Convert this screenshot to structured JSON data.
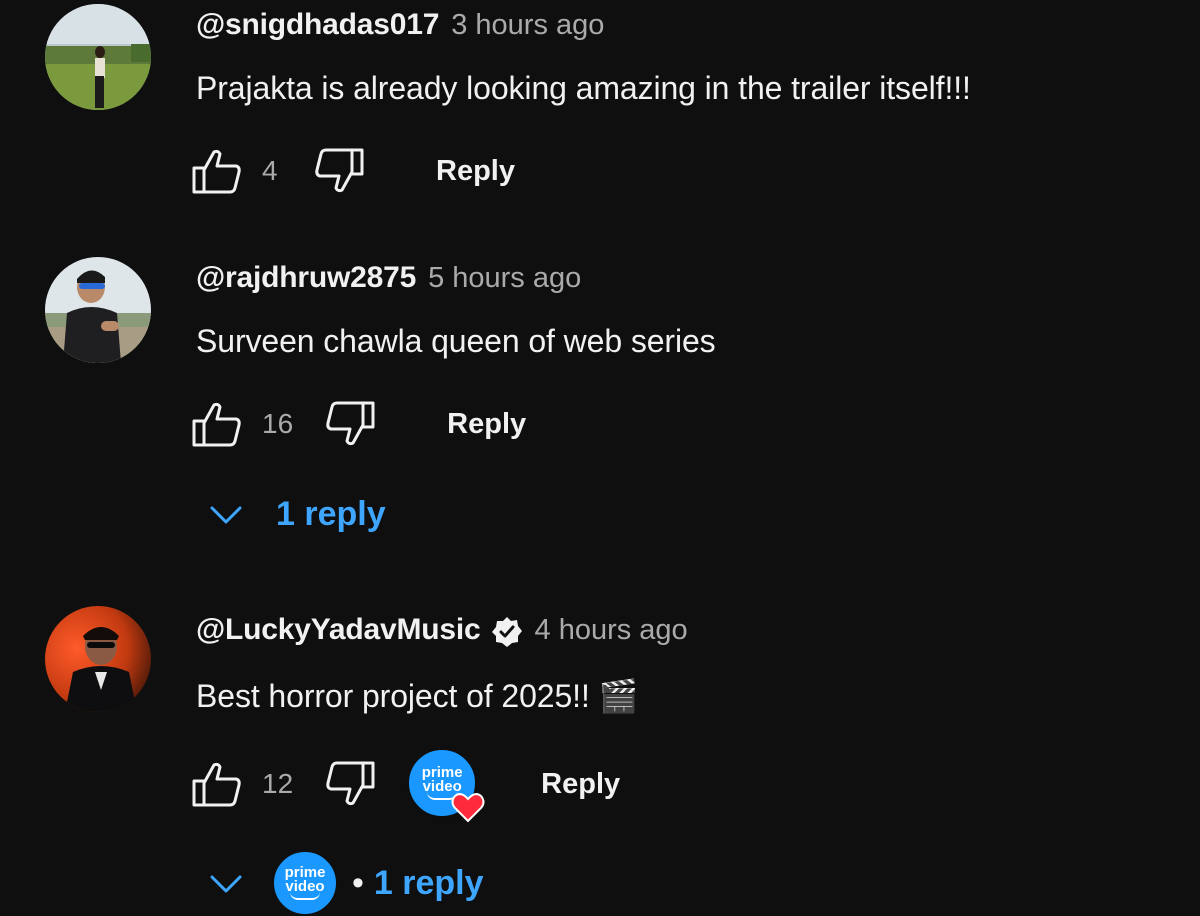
{
  "comments": [
    {
      "author": "@snigdhadas017",
      "time": "3 hours ago",
      "text": "Prajakta is already looking amazing in the trailer itself!!!",
      "likes": "4",
      "reply_label": "Reply"
    },
    {
      "author": "@rajdhruw2875",
      "time": "5 hours ago",
      "text": "Surveen chawla queen of web series",
      "likes": "16",
      "reply_label": "Reply",
      "replies_label": "1 reply"
    },
    {
      "author": "@LuckyYadavMusic",
      "verified": true,
      "time": "4 hours ago",
      "text": "Best horror project of 2025!! 🎬",
      "likes": "12",
      "reply_label": "Reply",
      "creator_heart": true,
      "creator_badge_text": [
        "prime",
        "video"
      ],
      "replies_dot": "•",
      "replies_label": "1 reply"
    }
  ],
  "colors": {
    "background": "#0f0f0f",
    "text": "#f1f1f1",
    "muted": "#aaaaaa",
    "link": "#3ea6ff",
    "prime_blue": "#1a98ff",
    "heart": "#ff2a3a"
  },
  "icons": [
    "like-icon",
    "dislike-icon",
    "chevron-down-icon",
    "verified-icon",
    "heart-icon"
  ]
}
